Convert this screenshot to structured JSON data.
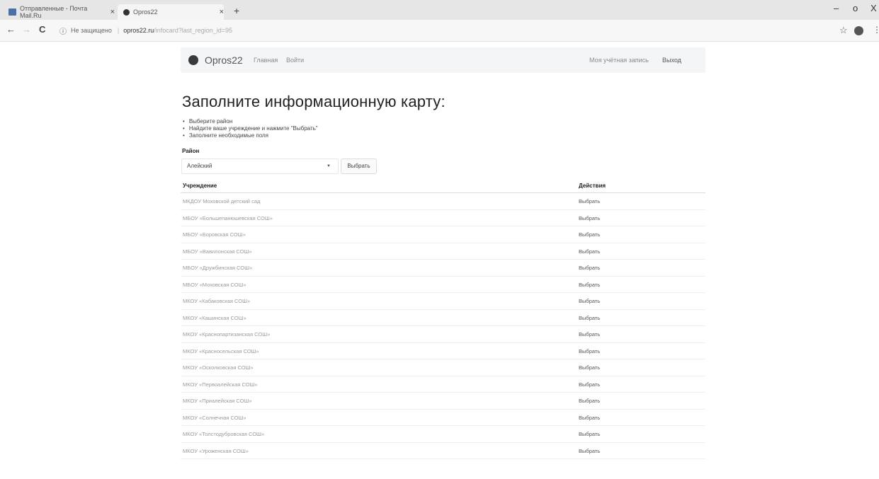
{
  "browser": {
    "tabs": [
      {
        "title": "Отправленные - Почта Mail.Ru"
      },
      {
        "title": "Opros22"
      }
    ],
    "new_tab": "+",
    "close": "×",
    "window_controls": [
      "–",
      "o",
      "X"
    ],
    "nav": {
      "back": "←",
      "forward": "→",
      "reload": "C"
    },
    "url": {
      "info": "ⓘ",
      "security": "Не защищено",
      "separator": "|",
      "host": "opros22.ru",
      "path": "/infocard?last_region_id=95"
    },
    "star": "☆",
    "menu": "⋮"
  },
  "site": {
    "brand": "Opros22",
    "nav_left": [
      "Главная",
      "Войти"
    ],
    "nav_right": [
      "Моя учётная запись",
      "Выход"
    ]
  },
  "page": {
    "title": "Заполните информационную карту:",
    "steps": [
      "Выберите район",
      "Найдите ваше учреждение и нажмите \"Выбрать\"",
      "Заполните необходимые поля"
    ],
    "district_label": "Район",
    "district_value": "Алейский",
    "select_caret": "▼",
    "choose_button": "Выбрать"
  },
  "table": {
    "headers": [
      "Учреждение",
      "Действия"
    ],
    "rows": [
      {
        "name": "МКДОУ Моховской детский сад",
        "action": "Выбрать"
      },
      {
        "name": "МБОУ «Большепанюшевская СОШ»",
        "action": "Выбрать"
      },
      {
        "name": "МБОУ «Боровская СОШ»",
        "action": "Выбрать"
      },
      {
        "name": "МБОУ «Вавилонская СОШ»",
        "action": "Выбрать"
      },
      {
        "name": "МБОУ «Дружбинская СОШ»",
        "action": "Выбрать"
      },
      {
        "name": "МБОУ «Моховская СОШ»",
        "action": "Выбрать"
      },
      {
        "name": "МКОУ «Кабаковская СОШ»",
        "action": "Выбрать"
      },
      {
        "name": "МКОУ «Кашинская СОШ»",
        "action": "Выбрать"
      },
      {
        "name": "МКОУ «Краснопартизанская СОШ»",
        "action": "Выбрать"
      },
      {
        "name": "МКОУ «Красносельская СОШ»",
        "action": "Выбрать"
      },
      {
        "name": "МКОУ «Осколковская СОШ»",
        "action": "Выбрать"
      },
      {
        "name": "МКОУ «Первоалейская СОШ»",
        "action": "Выбрать"
      },
      {
        "name": "МКОУ «Приалейская СОШ»",
        "action": "Выбрать"
      },
      {
        "name": "МКОУ «Солнечная СОШ»",
        "action": "Выбрать"
      },
      {
        "name": "МКОУ «Толстодубровская СОШ»",
        "action": "Выбрать"
      },
      {
        "name": "МКОУ «Уроженская СОШ»",
        "action": "Выбрать"
      }
    ]
  }
}
